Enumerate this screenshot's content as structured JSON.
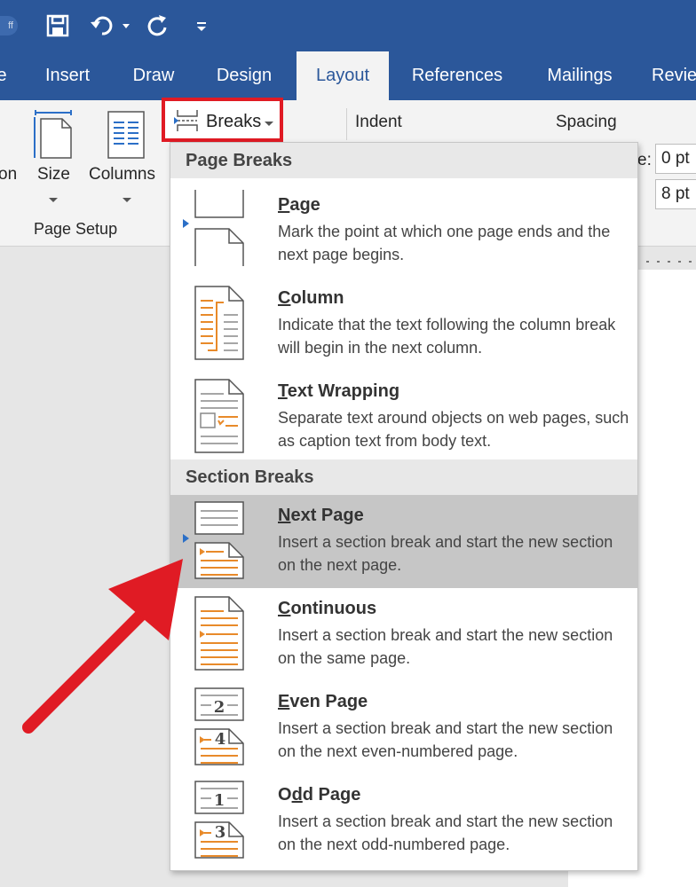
{
  "quick_access": {
    "autosave_label": "ff",
    "save_icon": "save-icon",
    "undo_icon": "undo-icon",
    "redo_icon": "repeat-icon",
    "customize_icon": "customize-qat-icon"
  },
  "tabs": [
    {
      "label": "e"
    },
    {
      "label": "Insert"
    },
    {
      "label": "Draw"
    },
    {
      "label": "Design"
    },
    {
      "label": "Layout"
    },
    {
      "label": "References"
    },
    {
      "label": "Mailings"
    },
    {
      "label": "Revie"
    }
  ],
  "ribbon": {
    "orientation_partial": "on",
    "size_label": "Size",
    "columns_label": "Columns",
    "group_label": "Page Setup",
    "breaks_label": "Breaks",
    "indent_label": "Indent",
    "spacing_label": "Spacing",
    "spacing_before_partial": "e:",
    "spacing_before": "0 pt",
    "spacing_after": "8 pt"
  },
  "breaks_menu": {
    "page_breaks_header": "Page Breaks",
    "section_breaks_header": "Section Breaks",
    "page_items": [
      {
        "title_ul": "P",
        "title_rest": "age",
        "desc": "Mark the point at which one page ends and the next page begins."
      },
      {
        "title_ul": "C",
        "title_rest": "olumn",
        "desc": "Indicate that the text following the column break will begin in the next column."
      },
      {
        "title_ul": "T",
        "title_rest": "ext Wrapping",
        "desc": "Separate text around objects on web pages, such as caption text from body text."
      }
    ],
    "section_items": [
      {
        "title_ul": "N",
        "title_rest": "ext Page",
        "desc": "Insert a section break and start the new section on the next page."
      },
      {
        "title_ul": "C",
        "title_rest": "ontinuous",
        "desc": "Insert a section break and start the new section on the same page."
      },
      {
        "title_ul": "E",
        "title_rest": "ven Page",
        "desc": "Insert a section break and start the new section on the next even-numbered page."
      },
      {
        "title_pre": "O",
        "title_ul": "d",
        "title_rest": "d Page",
        "desc": "Insert a section break and start the new section on the next odd-numbered page."
      }
    ],
    "even_icon_numbers": [
      "2",
      "4"
    ],
    "odd_icon_numbers": [
      "1",
      "3"
    ]
  },
  "colors": {
    "word_blue": "#2b579a",
    "highlight": "#e01b24",
    "accent_orange": "#e88a2a",
    "selection_gray": "#c6c6c6"
  }
}
